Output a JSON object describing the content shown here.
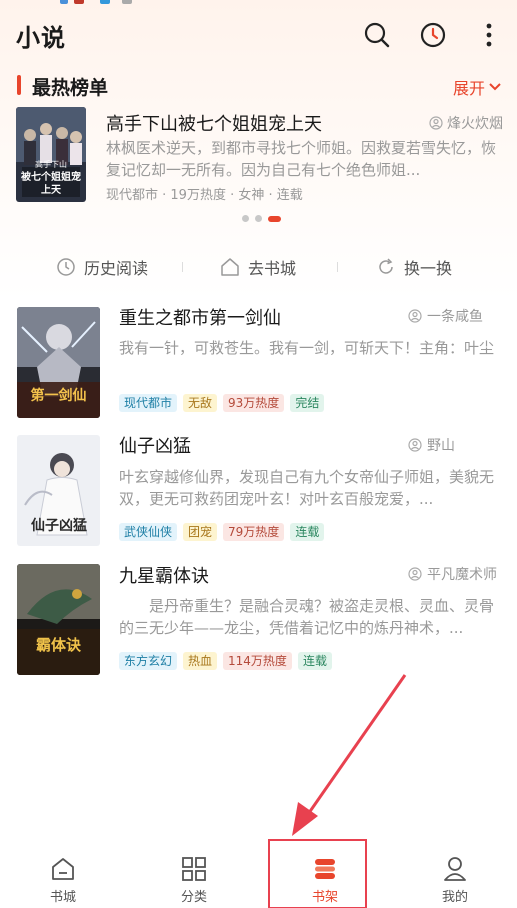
{
  "header": {
    "title": "小说",
    "icons": [
      "search-icon",
      "history-clock-icon",
      "more-vertical-icon"
    ]
  },
  "hot_list": {
    "title": "最热榜单",
    "expand_label": "展开",
    "book": {
      "title": "高手下山被七个姐姐宠上天",
      "author": "烽火炊烟",
      "description": "林枫医术逆天，到都市寻找七个师姐。因救夏若雪失忆，恢复记忆却一无所有。因为自己有七个绝色师姐...",
      "meta": "现代都市 · 19万热度 · 女神 · 连载",
      "cover_text_top": "高手下山",
      "cover_text_main": "被七个姐姐宠上天"
    },
    "carousel": {
      "count": 3,
      "active_index": 2
    }
  },
  "quick_actions": [
    {
      "label": "历史阅读",
      "icon": "clock-icon"
    },
    {
      "label": "去书城",
      "icon": "home-icon"
    },
    {
      "label": "换一换",
      "icon": "refresh-icon"
    }
  ],
  "books": [
    {
      "title": "重生之都市第一剑仙",
      "author": "一条咸鱼",
      "description": "我有一针，可救苍生。我有一剑，可斩天下！主角：叶尘",
      "tags": [
        "现代都市",
        "无敌",
        "93万热度",
        "完结"
      ],
      "cover_text": "第一剑仙"
    },
    {
      "title": "仙子凶猛",
      "author": "野山",
      "description": "叶玄穿越修仙界，发现自己有九个女帝仙子师姐，美貌无双，更无可救药团宠叶玄！对叶玄百般宠爱，...",
      "tags": [
        "武侠仙侠",
        "团宠",
        "79万热度",
        "连载"
      ],
      "cover_text": "仙子凶猛"
    },
    {
      "title": "九星霸体诀",
      "author": "平凡魔术师",
      "description": "　　是丹帝重生？是融合灵魂？被盗走灵根、灵血、灵骨的三无少年——龙尘，凭借着记忆中的炼丹神术，...",
      "tags": [
        "东方玄幻",
        "热血",
        "114万热度",
        "连载"
      ],
      "cover_text": "霸体诀"
    }
  ],
  "bottom_nav": {
    "items": [
      {
        "label": "书城",
        "icon": "bookstore-icon"
      },
      {
        "label": "分类",
        "icon": "category-grid-icon"
      },
      {
        "label": "书架",
        "icon": "bookshelf-icon"
      },
      {
        "label": "我的",
        "icon": "profile-icon"
      }
    ],
    "active_index": 2
  },
  "colors": {
    "accent": "#e8452c",
    "annotation": "#e8414f"
  }
}
